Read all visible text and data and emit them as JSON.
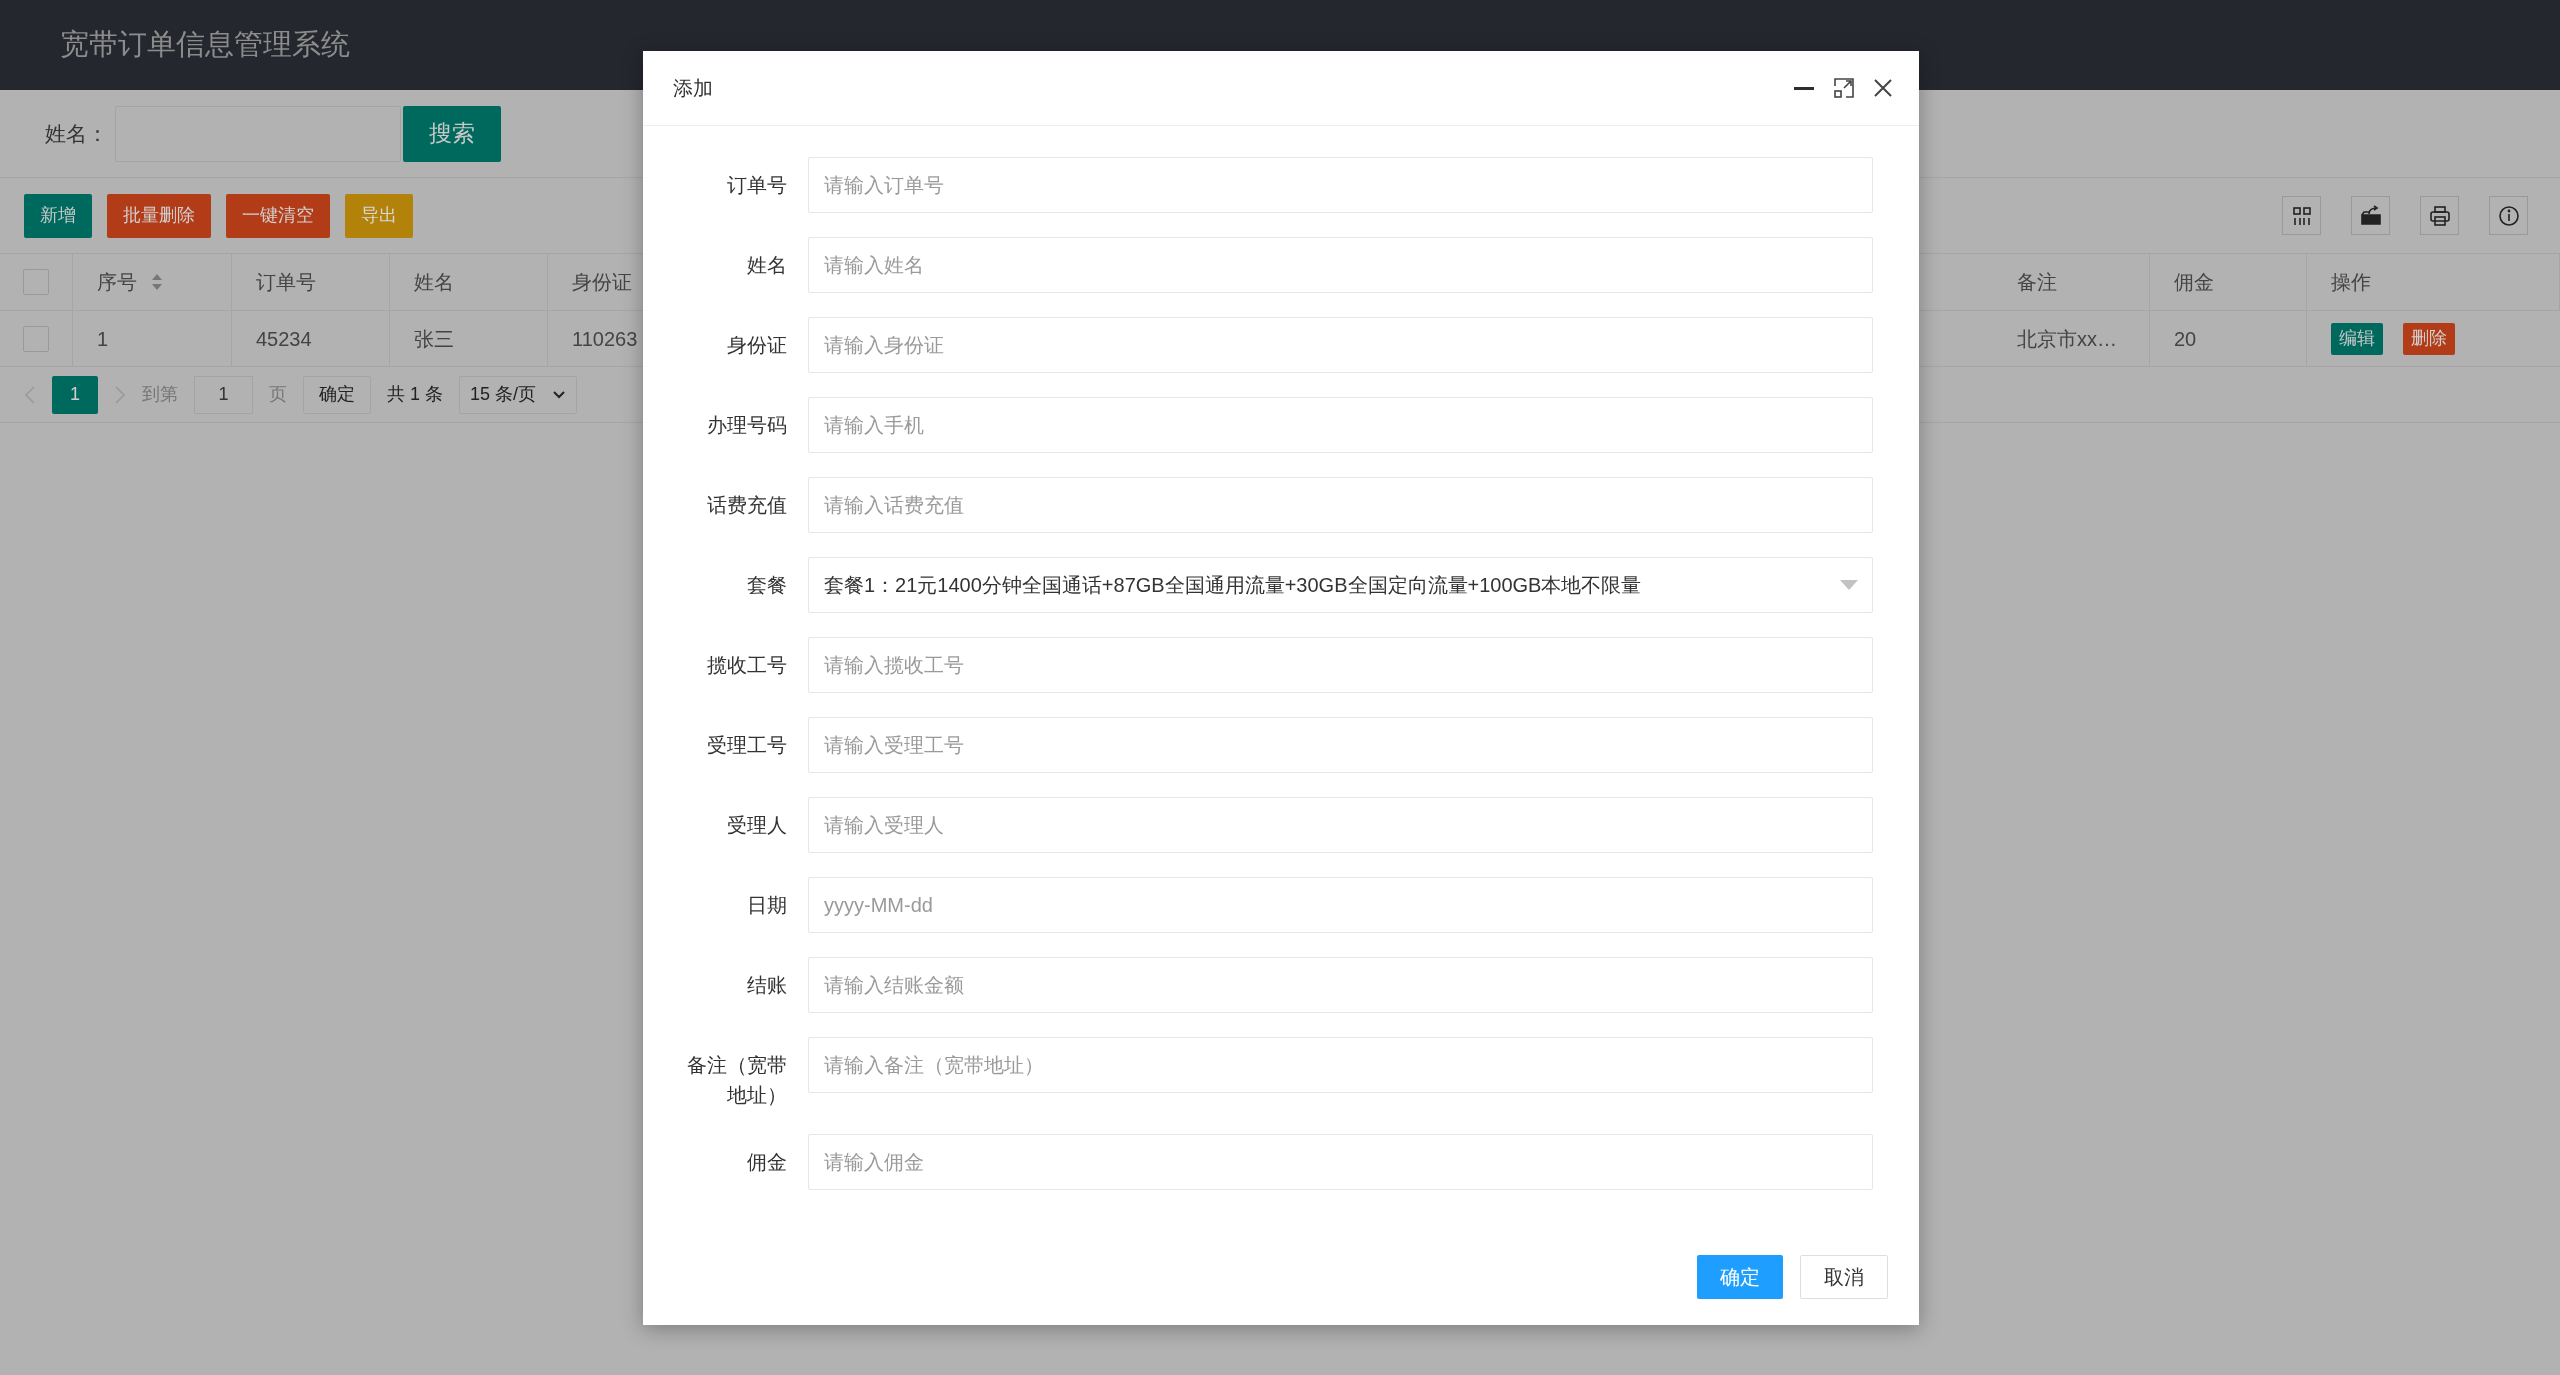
{
  "app_title": "宽带订单信息管理系统",
  "search": {
    "label": "姓名：",
    "button": "搜索"
  },
  "toolbar": {
    "buttons": [
      {
        "label": "新增",
        "kind": "primary"
      },
      {
        "label": "批量删除",
        "kind": "danger"
      },
      {
        "label": "一键清空",
        "kind": "danger"
      },
      {
        "label": "导出",
        "kind": "warning"
      }
    ]
  },
  "table": {
    "header_checked": false,
    "columns": [
      {
        "text": "序号",
        "sortable": true
      },
      {
        "text": "订单号"
      },
      {
        "text": "姓名"
      },
      {
        "text": "身份证"
      },
      {
        "text": "备注"
      },
      {
        "text": "佣金"
      },
      {
        "text": "操作"
      }
    ],
    "rows": [
      {
        "checked": false,
        "cells": [
          "1",
          "45234",
          "张三",
          "110263",
          "北京市xx…",
          "20"
        ],
        "actions": [
          {
            "label": "编辑",
            "kind": "primary"
          },
          {
            "label": "删除",
            "kind": "danger"
          }
        ]
      }
    ]
  },
  "pagination": {
    "pages": [
      {
        "label": "1",
        "selected": true
      }
    ],
    "goto_label": "到第",
    "goto_value": "1",
    "page_unit": "页",
    "confirm": "确定",
    "total": "共 1 条",
    "page_size": "15 条/页"
  },
  "dialog": {
    "title": "添加",
    "fields": [
      {
        "label": "订单号",
        "kind": "input",
        "placeholder": "请输入订单号"
      },
      {
        "label": "姓名",
        "kind": "input",
        "placeholder": "请输入姓名"
      },
      {
        "label": "身份证",
        "kind": "input",
        "placeholder": "请输入身份证"
      },
      {
        "label": "办理号码",
        "kind": "input",
        "placeholder": "请输入手机"
      },
      {
        "label": "话费充值",
        "kind": "input",
        "placeholder": "请输入话费充值"
      },
      {
        "label": "套餐",
        "kind": "select",
        "value": "套餐1：21元1400分钟全国通话+87GB全国通用流量+30GB全国定向流量+100GB本地不限量"
      },
      {
        "label": "揽收工号",
        "kind": "input",
        "placeholder": "请输入揽收工号"
      },
      {
        "label": "受理工号",
        "kind": "input",
        "placeholder": "请输入受理工号"
      },
      {
        "label": "受理人",
        "kind": "input",
        "placeholder": "请输入受理人"
      },
      {
        "label": "日期",
        "kind": "input",
        "placeholder": "yyyy-MM-dd"
      },
      {
        "label": "结账",
        "kind": "input",
        "placeholder": "请输入结账金额"
      },
      {
        "label": "备注（宽带地址）",
        "kind": "input",
        "placeholder": "请输入备注（宽带地址）"
      },
      {
        "label": "佣金",
        "kind": "input",
        "placeholder": "请输入佣金"
      }
    ],
    "buttons": [
      {
        "label": "确定",
        "kind": "primary"
      },
      {
        "label": "取消",
        "kind": "default"
      }
    ]
  }
}
